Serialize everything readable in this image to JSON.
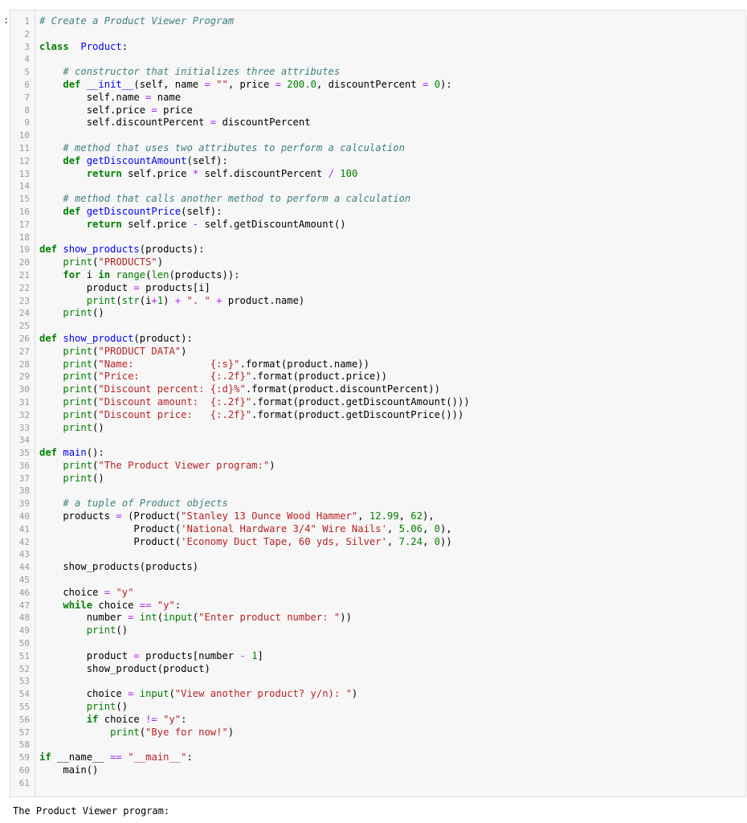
{
  "prompt": ":",
  "output_text": "The Product Viewer program:",
  "lines": [
    [
      [
        "cm",
        "# Create a Product Viewer Program"
      ]
    ],
    [],
    [
      [
        "kw",
        "class"
      ],
      [
        "",
        "  "
      ],
      [
        "fn",
        "Product"
      ],
      [
        "",
        ":"
      ]
    ],
    [],
    [
      [
        "",
        "    "
      ],
      [
        "cm",
        "# constructor that initializes three attributes"
      ]
    ],
    [
      [
        "",
        "    "
      ],
      [
        "kw",
        "def"
      ],
      [
        "",
        " "
      ],
      [
        "fn",
        "__init__"
      ],
      [
        "",
        "(self, name "
      ],
      [
        "op",
        "="
      ],
      [
        "",
        " "
      ],
      [
        "st",
        "\"\""
      ],
      [
        "",
        ", price "
      ],
      [
        "op",
        "="
      ],
      [
        "",
        " "
      ],
      [
        "nm",
        "200.0"
      ],
      [
        "",
        ", discountPercent "
      ],
      [
        "op",
        "="
      ],
      [
        "",
        " "
      ],
      [
        "nm",
        "0"
      ],
      [
        "",
        "):"
      ]
    ],
    [
      [
        "",
        "        self.name "
      ],
      [
        "op",
        "="
      ],
      [
        "",
        " name"
      ]
    ],
    [
      [
        "",
        "        self.price "
      ],
      [
        "op",
        "="
      ],
      [
        "",
        " price"
      ]
    ],
    [
      [
        "",
        "        self.discountPercent "
      ],
      [
        "op",
        "="
      ],
      [
        "",
        " discountPercent"
      ]
    ],
    [],
    [
      [
        "",
        "    "
      ],
      [
        "cm",
        "# method that uses two attributes to perform a calculation"
      ]
    ],
    [
      [
        "",
        "    "
      ],
      [
        "kw",
        "def"
      ],
      [
        "",
        " "
      ],
      [
        "fn",
        "getDiscountAmount"
      ],
      [
        "",
        "(self):"
      ]
    ],
    [
      [
        "",
        "        "
      ],
      [
        "kw",
        "return"
      ],
      [
        "",
        " self.price "
      ],
      [
        "op",
        "*"
      ],
      [
        "",
        " self.discountPercent "
      ],
      [
        "op",
        "/"
      ],
      [
        "",
        " "
      ],
      [
        "nm",
        "100"
      ]
    ],
    [],
    [
      [
        "",
        "    "
      ],
      [
        "cm",
        "# method that calls another method to perform a calculation"
      ]
    ],
    [
      [
        "",
        "    "
      ],
      [
        "kw",
        "def"
      ],
      [
        "",
        " "
      ],
      [
        "fn",
        "getDiscountPrice"
      ],
      [
        "",
        "(self):"
      ]
    ],
    [
      [
        "",
        "        "
      ],
      [
        "kw",
        "return"
      ],
      [
        "",
        " self.price "
      ],
      [
        "op",
        "-"
      ],
      [
        "",
        " self.getDiscountAmount()"
      ]
    ],
    [],
    [
      [
        "kw",
        "def"
      ],
      [
        "",
        " "
      ],
      [
        "fn",
        "show_products"
      ],
      [
        "",
        "(products):"
      ]
    ],
    [
      [
        "",
        "    "
      ],
      [
        "bi",
        "print"
      ],
      [
        "",
        "("
      ],
      [
        "st",
        "\"PRODUCTS\""
      ],
      [
        "",
        ")"
      ]
    ],
    [
      [
        "",
        "    "
      ],
      [
        "kw",
        "for"
      ],
      [
        "",
        " i "
      ],
      [
        "kw",
        "in"
      ],
      [
        "",
        " "
      ],
      [
        "bi",
        "range"
      ],
      [
        "",
        "("
      ],
      [
        "bi",
        "len"
      ],
      [
        "",
        "(products)):"
      ]
    ],
    [
      [
        "",
        "        product "
      ],
      [
        "op",
        "="
      ],
      [
        "",
        " products[i]"
      ]
    ],
    [
      [
        "",
        "        "
      ],
      [
        "bi",
        "print"
      ],
      [
        "",
        "("
      ],
      [
        "bi",
        "str"
      ],
      [
        "",
        "(i"
      ],
      [
        "op",
        "+"
      ],
      [
        "nm",
        "1"
      ],
      [
        "",
        ") "
      ],
      [
        "op",
        "+"
      ],
      [
        "",
        " "
      ],
      [
        "st",
        "\". \""
      ],
      [
        "",
        " "
      ],
      [
        "op",
        "+"
      ],
      [
        "",
        " product.name)"
      ]
    ],
    [
      [
        "",
        "    "
      ],
      [
        "bi",
        "print"
      ],
      [
        "",
        "()"
      ]
    ],
    [],
    [
      [
        "kw",
        "def"
      ],
      [
        "",
        " "
      ],
      [
        "fn",
        "show_product"
      ],
      [
        "",
        "(product):"
      ]
    ],
    [
      [
        "",
        "    "
      ],
      [
        "bi",
        "print"
      ],
      [
        "",
        "("
      ],
      [
        "st",
        "\"PRODUCT DATA\""
      ],
      [
        "",
        ")"
      ]
    ],
    [
      [
        "",
        "    "
      ],
      [
        "bi",
        "print"
      ],
      [
        "",
        "("
      ],
      [
        "st",
        "\"Name:             {:s}\""
      ],
      [
        "",
        ".format(product.name))"
      ]
    ],
    [
      [
        "",
        "    "
      ],
      [
        "bi",
        "print"
      ],
      [
        "",
        "("
      ],
      [
        "st",
        "\"Price:            {:.2f}\""
      ],
      [
        "",
        ".format(product.price))"
      ]
    ],
    [
      [
        "",
        "    "
      ],
      [
        "bi",
        "print"
      ],
      [
        "",
        "("
      ],
      [
        "st",
        "\"Discount percent: {:d}%\""
      ],
      [
        "",
        ".format(product.discountPercent))"
      ]
    ],
    [
      [
        "",
        "    "
      ],
      [
        "bi",
        "print"
      ],
      [
        "",
        "("
      ],
      [
        "st",
        "\"Discount amount:  {:.2f}\""
      ],
      [
        "",
        ".format(product.getDiscountAmount()))"
      ]
    ],
    [
      [
        "",
        "    "
      ],
      [
        "bi",
        "print"
      ],
      [
        "",
        "("
      ],
      [
        "st",
        "\"Discount price:   {:.2f}\""
      ],
      [
        "",
        ".format(product.getDiscountPrice()))"
      ]
    ],
    [
      [
        "",
        "    "
      ],
      [
        "bi",
        "print"
      ],
      [
        "",
        "()"
      ]
    ],
    [],
    [
      [
        "kw",
        "def"
      ],
      [
        "",
        " "
      ],
      [
        "fn",
        "main"
      ],
      [
        "",
        "():"
      ]
    ],
    [
      [
        "",
        "    "
      ],
      [
        "bi",
        "print"
      ],
      [
        "",
        "("
      ],
      [
        "st",
        "\"The Product Viewer program:\""
      ],
      [
        "",
        ")"
      ]
    ],
    [
      [
        "",
        "    "
      ],
      [
        "bi",
        "print"
      ],
      [
        "",
        "()"
      ]
    ],
    [],
    [
      [
        "",
        "    "
      ],
      [
        "cm",
        "# a tuple of Product objects"
      ]
    ],
    [
      [
        "",
        "    products "
      ],
      [
        "op",
        "="
      ],
      [
        "",
        " (Product("
      ],
      [
        "st",
        "\"Stanley 13 Ounce Wood Hammer\""
      ],
      [
        "",
        ", "
      ],
      [
        "nm",
        "12.99"
      ],
      [
        "",
        ", "
      ],
      [
        "nm",
        "62"
      ],
      [
        "",
        "),"
      ]
    ],
    [
      [
        "",
        "                Product("
      ],
      [
        "st",
        "'National Hardware 3/4\" Wire Nails'"
      ],
      [
        "",
        ", "
      ],
      [
        "nm",
        "5.06"
      ],
      [
        "",
        ", "
      ],
      [
        "nm",
        "0"
      ],
      [
        "",
        "),"
      ]
    ],
    [
      [
        "",
        "                Product("
      ],
      [
        "st",
        "'Economy Duct Tape, 60 yds, Silver'"
      ],
      [
        "",
        ", "
      ],
      [
        "nm",
        "7.24"
      ],
      [
        "",
        ", "
      ],
      [
        "nm",
        "0"
      ],
      [
        "",
        "))"
      ]
    ],
    [],
    [
      [
        "",
        "    show_products(products)"
      ]
    ],
    [],
    [
      [
        "",
        "    choice "
      ],
      [
        "op",
        "="
      ],
      [
        "",
        " "
      ],
      [
        "st",
        "\"y\""
      ]
    ],
    [
      [
        "",
        "    "
      ],
      [
        "kw",
        "while"
      ],
      [
        "",
        " choice "
      ],
      [
        "op",
        "=="
      ],
      [
        "",
        " "
      ],
      [
        "st",
        "\"y\""
      ],
      [
        "",
        ":"
      ]
    ],
    [
      [
        "",
        "        number "
      ],
      [
        "op",
        "="
      ],
      [
        "",
        " "
      ],
      [
        "bi",
        "int"
      ],
      [
        "",
        "("
      ],
      [
        "bi",
        "input"
      ],
      [
        "",
        "("
      ],
      [
        "st",
        "\"Enter product number: \""
      ],
      [
        "",
        "))"
      ]
    ],
    [
      [
        "",
        "        "
      ],
      [
        "bi",
        "print"
      ],
      [
        "",
        "()"
      ]
    ],
    [],
    [
      [
        "",
        "        product "
      ],
      [
        "op",
        "="
      ],
      [
        "",
        " products[number "
      ],
      [
        "op",
        "-"
      ],
      [
        "",
        " "
      ],
      [
        "nm",
        "1"
      ],
      [
        "",
        "]"
      ]
    ],
    [
      [
        "",
        "        show_product(product)"
      ]
    ],
    [],
    [
      [
        "",
        "        choice "
      ],
      [
        "op",
        "="
      ],
      [
        "",
        " "
      ],
      [
        "bi",
        "input"
      ],
      [
        "",
        "("
      ],
      [
        "st",
        "\"View another product? y/n): \""
      ],
      [
        "",
        ")"
      ]
    ],
    [
      [
        "",
        "        "
      ],
      [
        "bi",
        "print"
      ],
      [
        "",
        "()"
      ]
    ],
    [
      [
        "",
        "        "
      ],
      [
        "kw",
        "if"
      ],
      [
        "",
        " choice "
      ],
      [
        "op",
        "!="
      ],
      [
        "",
        " "
      ],
      [
        "st",
        "\"y\""
      ],
      [
        "",
        ":"
      ]
    ],
    [
      [
        "",
        "            "
      ],
      [
        "bi",
        "print"
      ],
      [
        "",
        "("
      ],
      [
        "st",
        "\"Bye for now!\""
      ],
      [
        "",
        ")"
      ]
    ],
    [],
    [
      [
        "kw",
        "if"
      ],
      [
        "",
        " __name__ "
      ],
      [
        "op",
        "=="
      ],
      [
        "",
        " "
      ],
      [
        "st",
        "\"__main__\""
      ],
      [
        "",
        ":"
      ]
    ],
    [
      [
        "",
        "    main()"
      ]
    ],
    []
  ]
}
